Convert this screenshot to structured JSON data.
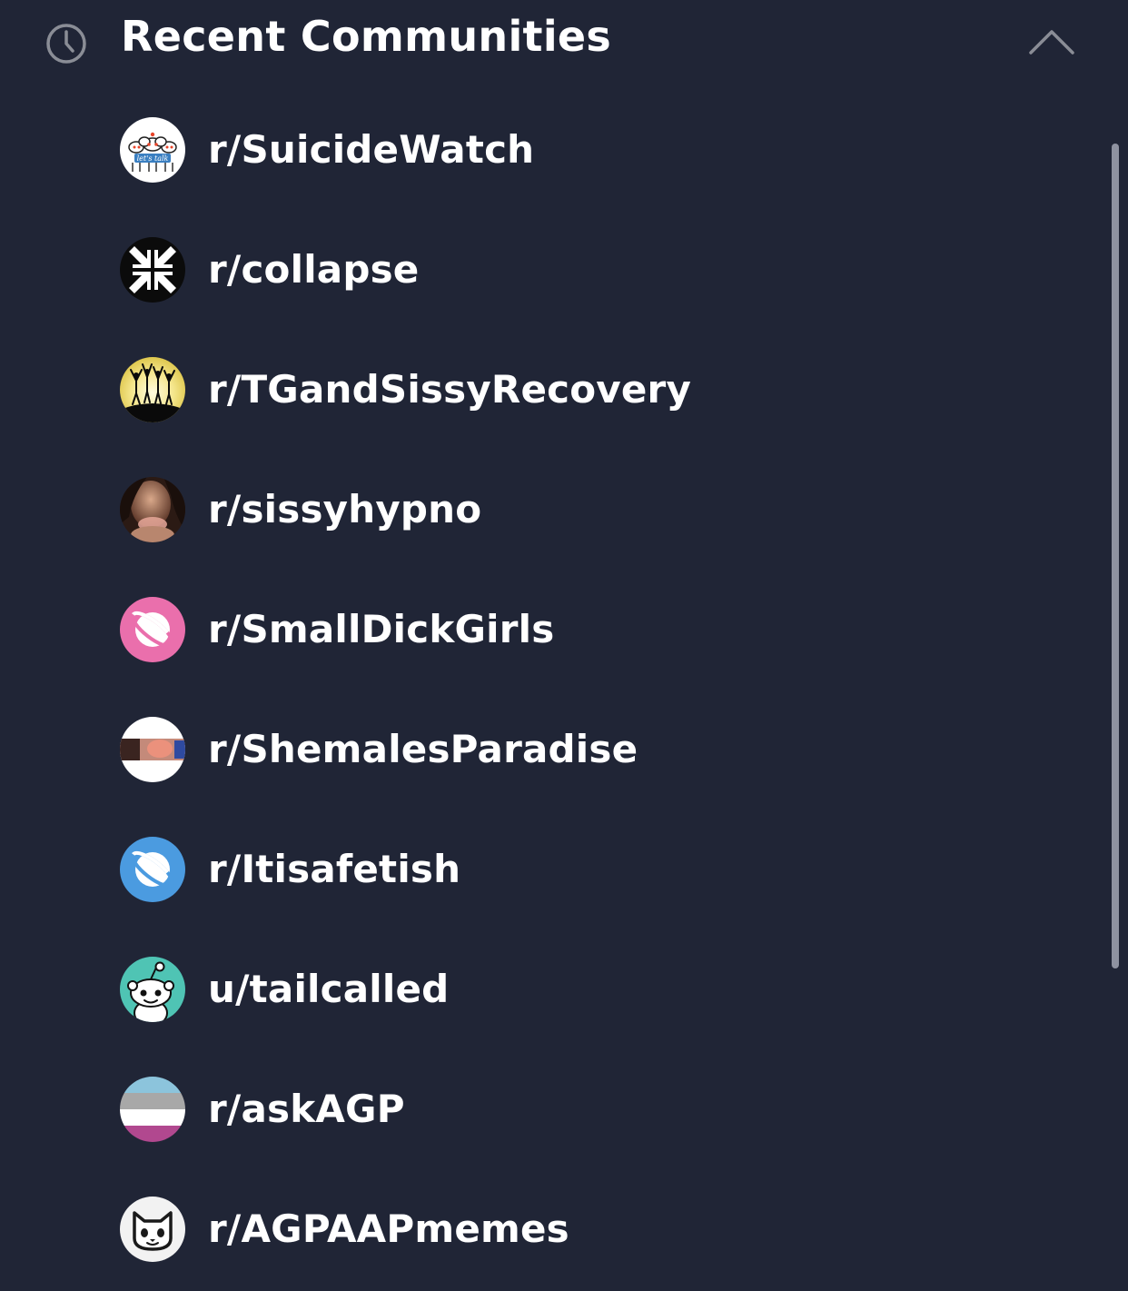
{
  "header": {
    "title": "Recent Communities",
    "icon": "clock-icon",
    "collapse_icon": "chevron-up-icon"
  },
  "colors": {
    "background": "#202536",
    "text": "#ffffff",
    "icon": "#8a8d96",
    "scrollbar": "#8e92a0",
    "planet_pink": "#ea6fac",
    "planet_blue": "#4b9be0",
    "snoo_teal": "#4fc4b4"
  },
  "communities": [
    {
      "name": "r/SuicideWatch",
      "avatar": "snoo-group-lets-talk-icon",
      "avatar_text": "let's talk"
    },
    {
      "name": "r/collapse",
      "avatar": "collapse-arrows-icon"
    },
    {
      "name": "r/TGandSissyRecovery",
      "avatar": "silhouettes-hilltop-icon"
    },
    {
      "name": "r/sissyhypno",
      "avatar": "photo-portrait-icon"
    },
    {
      "name": "r/SmallDickGirls",
      "avatar": "planet-pink-icon"
    },
    {
      "name": "r/ShemalesParadise",
      "avatar": "photo-banner-icon"
    },
    {
      "name": "r/Itisafetish",
      "avatar": "planet-blue-icon"
    },
    {
      "name": "u/tailcalled",
      "avatar": "snoo-teal-icon"
    },
    {
      "name": "r/askAGP",
      "avatar": "striped-flag-icon"
    },
    {
      "name": "r/AGPAAPmemes",
      "avatar": "cat-face-icon"
    }
  ]
}
